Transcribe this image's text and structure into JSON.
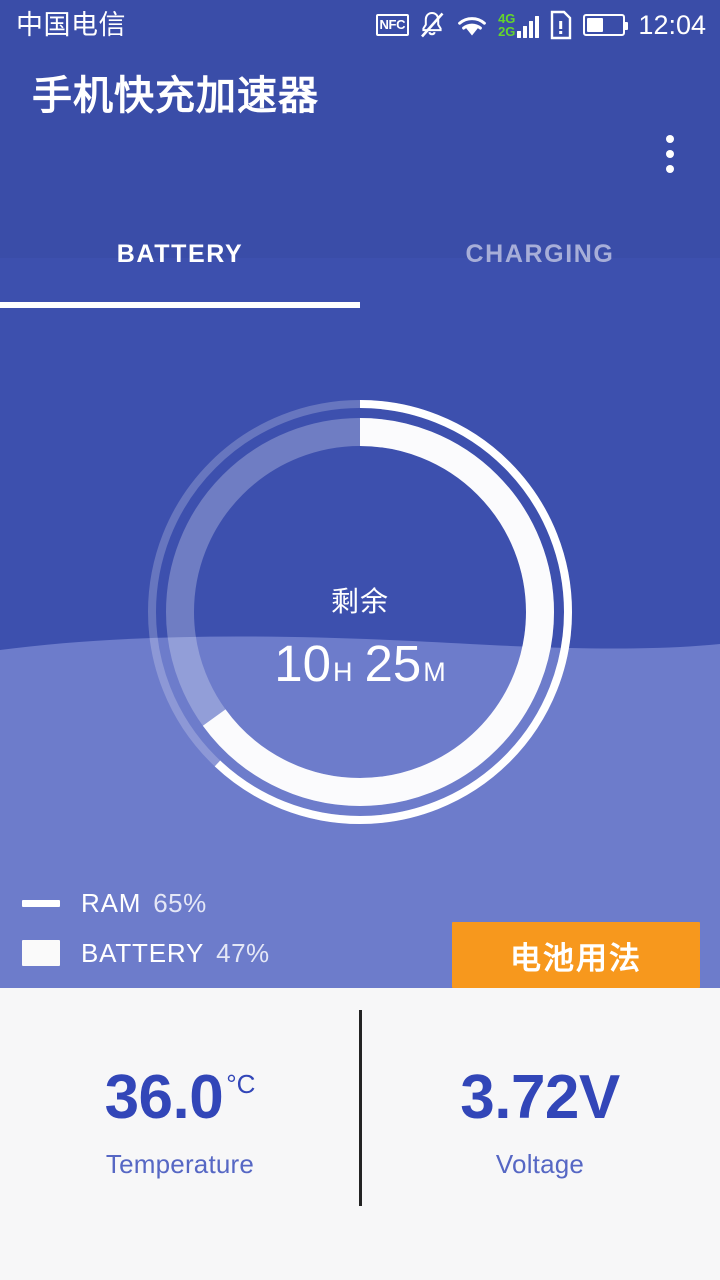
{
  "status_bar": {
    "carrier": "中国电信",
    "time": "12:04",
    "icons": {
      "nfc": "NFC",
      "mute": "bell-muted-icon",
      "wifi": "wifi-icon",
      "signal_primary": "4G",
      "signal_secondary": "2G",
      "sim_alert": "sim-card-alert-icon",
      "battery": "battery-icon"
    },
    "battery_fill_percent": 40,
    "colors": {
      "background": "#3a4da8",
      "signal_label": "#64d62a",
      "foreground": "#ffffff"
    }
  },
  "app_bar": {
    "title": "手机快充加速器",
    "overflow_menu": "overflow-menu",
    "tabs": [
      {
        "label": "BATTERY",
        "active": true
      },
      {
        "label": "CHARGING",
        "active": false
      }
    ]
  },
  "hero": {
    "remaining_label": "剩余",
    "remaining_hours": "10",
    "remaining_hours_unit": "H",
    "remaining_minutes": "25",
    "remaining_minutes_unit": "M",
    "gauge": {
      "outer_ring_percent": 62,
      "inner_ring_percent": 65,
      "start_angle_deg": 0
    },
    "legend": [
      {
        "name": "RAM",
        "value": "65%",
        "marker": "line"
      },
      {
        "name": "BATTERY",
        "value": "47%",
        "marker": "block"
      }
    ],
    "action_button": {
      "label": "电池用法",
      "color": "#f7981d"
    },
    "colors": {
      "top_background": "#3d50ae",
      "bottom_background": "#6d7ccb"
    }
  },
  "stats": {
    "items": [
      {
        "value": "36.0",
        "unit": "°C",
        "label": "Temperature"
      },
      {
        "value": "3.72V",
        "unit": "",
        "label": "Voltage"
      }
    ],
    "accent_color": "#3246b8"
  }
}
